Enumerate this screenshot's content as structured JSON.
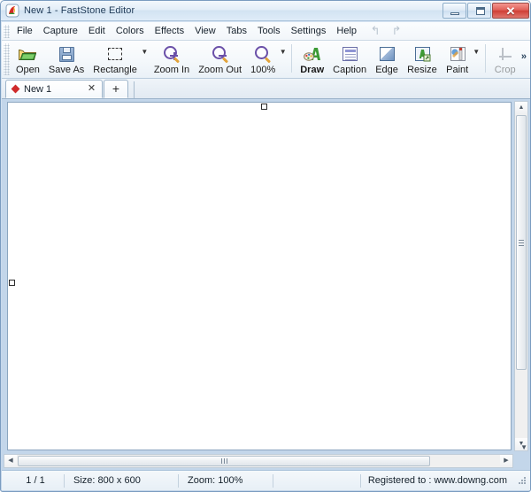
{
  "window": {
    "title": "New 1 - FastStone Editor",
    "app_icon": "faststone-logo-icon",
    "minimize_label": "",
    "maximize_label": "",
    "close_label": "✕"
  },
  "menubar": {
    "items": [
      {
        "label": "File"
      },
      {
        "label": "Capture"
      },
      {
        "label": "Edit"
      },
      {
        "label": "Colors"
      },
      {
        "label": "Effects"
      },
      {
        "label": "View"
      },
      {
        "label": "Tabs"
      },
      {
        "label": "Tools"
      },
      {
        "label": "Settings"
      },
      {
        "label": "Help"
      }
    ],
    "undo_glyph": "↰",
    "redo_glyph": "↱"
  },
  "toolbar": {
    "buttons": [
      {
        "label": "Open",
        "icon": "open-folder-icon",
        "enabled": true,
        "dropdown": false
      },
      {
        "label": "Save As",
        "icon": "floppy-disk-icon",
        "enabled": true,
        "dropdown": false
      },
      {
        "label": "Rectangle",
        "icon": "marquee-select-icon",
        "enabled": true,
        "dropdown": true
      },
      {
        "label": "Zoom In",
        "icon": "magnifier-plus-icon",
        "enabled": true,
        "dropdown": false
      },
      {
        "label": "Zoom Out",
        "icon": "magnifier-minus-icon",
        "enabled": true,
        "dropdown": false
      },
      {
        "label": "100%",
        "icon": "magnifier-icon",
        "enabled": true,
        "dropdown": true
      },
      {
        "label": "Draw",
        "icon": "draw-palette-icon",
        "enabled": true,
        "dropdown": false,
        "bold": true
      },
      {
        "label": "Caption",
        "icon": "caption-icon",
        "enabled": true,
        "dropdown": false
      },
      {
        "label": "Edge",
        "icon": "edge-effect-icon",
        "enabled": true,
        "dropdown": false
      },
      {
        "label": "Resize",
        "icon": "resize-image-icon",
        "enabled": true,
        "dropdown": false
      },
      {
        "label": "Paint",
        "icon": "paint-brush-icon",
        "enabled": true,
        "dropdown": true
      },
      {
        "label": "Crop",
        "icon": "crop-icon",
        "enabled": false,
        "dropdown": false
      }
    ],
    "caret_glyph": "▼",
    "overflow_glyph": "»"
  },
  "tabs": {
    "items": [
      {
        "label": "New 1",
        "marker": "unsaved-diamond-icon",
        "close_glyph": "✕",
        "active": true
      }
    ],
    "new_tab_glyph": "+"
  },
  "canvas": {
    "handles": [
      {
        "name": "selection-handle-top"
      },
      {
        "name": "selection-handle-left"
      }
    ]
  },
  "scrollbars": {
    "v_up_glyph": "▲",
    "v_down_glyph": "▼",
    "h_left_glyph": "◀",
    "h_right_glyph": "▶",
    "corner_glyph": "▼"
  },
  "statusbar": {
    "page": "1 / 1",
    "size": "Size: 800 x 600",
    "zoom": "Zoom: 100%",
    "registered": "Registered to : www.downg.com"
  },
  "colors": {
    "titlebar_accent": "#d2e3f2",
    "close_button": "#cf3f35",
    "frame_border": "#7a9cc0",
    "workarea_bg": "#c3d6ea",
    "canvas_bg": "#ffffff",
    "tab_marker": "#cf2a2a",
    "draw_icon_green": "#3c9a34",
    "magnifier_purple": "#6a4fa8"
  }
}
